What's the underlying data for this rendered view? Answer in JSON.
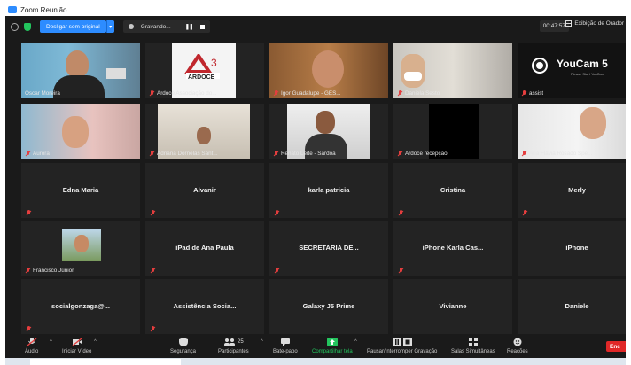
{
  "window": {
    "title": "Zoom Reunião"
  },
  "topbar": {
    "original_sound_label": "Desligar som original",
    "recording_label": "Gravando...",
    "timer": "00:47:57",
    "speaker_view_label": "Exibição de Orador"
  },
  "tiles": [
    {
      "label": "Oscar Moreira",
      "muted": false,
      "video": "person-blue",
      "active": true
    },
    {
      "label": "Ardoce Associação do...",
      "muted": true,
      "video": "logo"
    },
    {
      "label": "Igor Guadalupe - GES...",
      "muted": true,
      "video": "person-wood"
    },
    {
      "label": "Daniela Sesto",
      "muted": true,
      "video": "person-wall"
    },
    {
      "label": "assist",
      "muted": true,
      "video": "youcam",
      "youcam_text": "YouCam 5",
      "youcam_sub": "Please Start YouCam"
    },
    {
      "label": "Aurora",
      "muted": true,
      "video": "person-pink"
    },
    {
      "label": "Adriana Dornelas Sant...",
      "muted": true,
      "video": "person-room"
    },
    {
      "label": "Renato Leite - Sardoa",
      "muted": true,
      "video": "person-dark"
    },
    {
      "label": "Ardoce recepção",
      "muted": true,
      "video": "black"
    },
    {
      "label": "Ana Flávia Rosado Spe...",
      "muted": true,
      "video": "person-light"
    },
    {
      "name": "Edna Maria",
      "muted": true
    },
    {
      "name": "Alvanir",
      "muted": true
    },
    {
      "name": "karla patricia",
      "muted": true
    },
    {
      "name": "Cristina",
      "muted": true
    },
    {
      "name": "Merly",
      "muted": true
    },
    {
      "label": "Francisco Júnior",
      "muted": true,
      "video": "avatar-photo"
    },
    {
      "name": "iPad de Ana Paula",
      "muted": true
    },
    {
      "name": "SECRETARIA  DE...",
      "muted": true
    },
    {
      "name": "iPhone Karla Cas...",
      "muted": true
    },
    {
      "name": "iPhone",
      "muted": false
    },
    {
      "name": "socialgonzaga@...",
      "muted": true
    },
    {
      "name": "Assistência  Socia...",
      "muted": true
    },
    {
      "name": "Galaxy J5 Prime",
      "muted": false
    },
    {
      "name": "Vivianne",
      "muted": false
    },
    {
      "name": "Daniele",
      "muted": false
    }
  ],
  "toolbar": {
    "audio": "Áudio",
    "video": "Iniciar Vídeo",
    "security": "Segurança",
    "participants": "Participantes",
    "participants_count": "25",
    "chat": "Bate-papo",
    "share": "Compartilhar tela",
    "pause": "Pausar/Interromper Gravação",
    "breakout": "Salas Simultâneas",
    "reactions": "Reações",
    "end": "Enc"
  },
  "colors": {
    "accent": "#2d8cff",
    "share_green": "#23c55e",
    "muted_red": "#e53e3e",
    "end_red": "#e02828",
    "active_speaker": "#d8e86a"
  }
}
